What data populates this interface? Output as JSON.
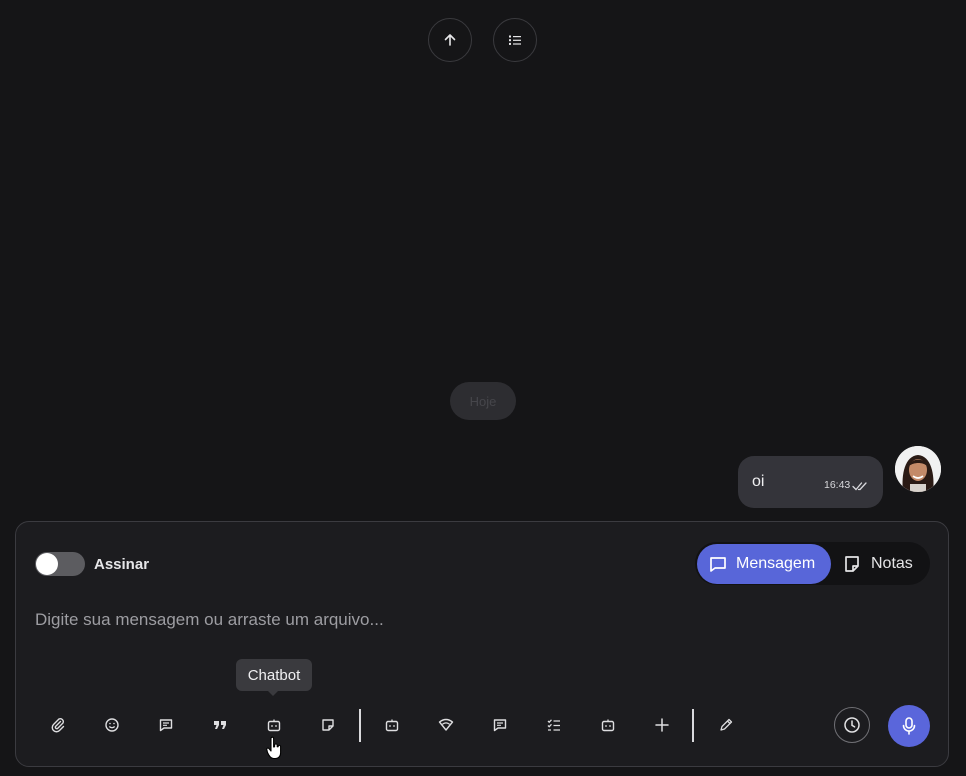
{
  "top_controls": {
    "scroll_up_icon": "arrow-up-icon",
    "list_icon": "list-icon"
  },
  "chat": {
    "date_chip": "Hoje",
    "message": {
      "text": "oi",
      "time": "16:43",
      "status_icon": "double-check-icon"
    }
  },
  "composer": {
    "sign_label": "Assinar",
    "sign_enabled": false,
    "mode_tabs": [
      {
        "label": "Mensagem",
        "icon": "chat-bubble-icon",
        "active": true
      },
      {
        "label": "Notas",
        "icon": "note-icon",
        "active": false
      }
    ],
    "placeholder": "Digite sua mensagem ou arraste um arquivo...",
    "tooltip": "Chatbot",
    "toolbar_icons": [
      "paperclip-icon",
      "emoji-icon",
      "message-square-icon",
      "quote-icon",
      "chatbot-icon",
      "sticker-icon",
      "bot-icon",
      "signal-icon",
      "comment-icon",
      "checklist-icon",
      "bot-alt-icon",
      "plus-icon",
      "pencil-icon",
      "clock-icon",
      "microphone-icon"
    ]
  },
  "colors": {
    "background": "#151517",
    "accent": "#5866d9",
    "bubble": "#34343a"
  }
}
